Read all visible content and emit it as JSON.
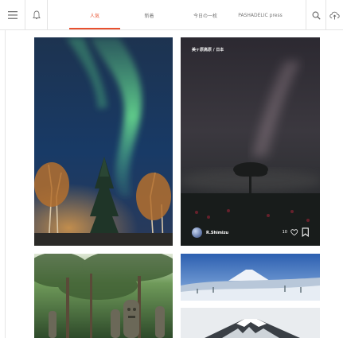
{
  "nav": {
    "tabs": [
      {
        "label": "人気",
        "active": true
      },
      {
        "label": "新着",
        "active": false
      },
      {
        "label": "今日の一枚",
        "active": false
      },
      {
        "label": "PASHADELIC press",
        "active": false
      }
    ],
    "icons": [
      "menu-icon",
      "bell-icon",
      "search-icon",
      "upload-cloud-icon"
    ],
    "accent_color": "#e8502e"
  },
  "feed": {
    "featured": {
      "caption": "美ヶ原高原 / 日本",
      "author": "R.Shimizu",
      "likes": "10"
    }
  }
}
